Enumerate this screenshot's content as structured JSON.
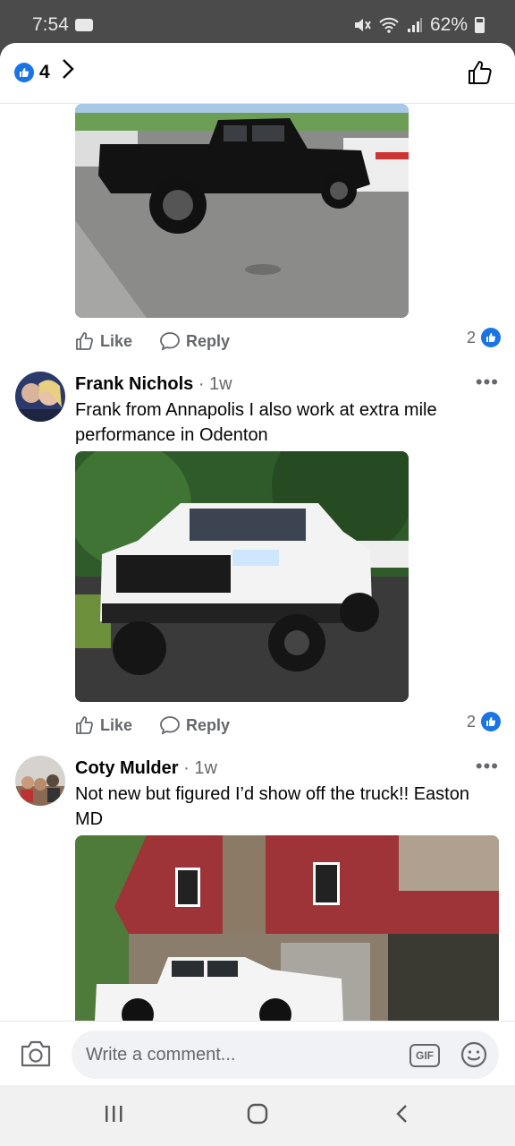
{
  "status": {
    "time": "7:54",
    "battery": "62%"
  },
  "header": {
    "reaction_count": "4",
    "reaction_icon": "like-badge-icon",
    "next_icon": "chevron-right-icon",
    "like_icon": "thumbs-up-icon"
  },
  "comments": [
    {
      "actions": {
        "like": "Like",
        "reply": "Reply"
      },
      "reactions": "2"
    },
    {
      "author": "Frank Nichols",
      "time": "· 1w",
      "text": "Frank from Annapolis I also work at extra mile performance in Odenton",
      "actions": {
        "like": "Like",
        "reply": "Reply"
      },
      "reactions": "2"
    },
    {
      "author": "Coty Mulder",
      "time": "· 1w",
      "text": "Not new but figured I’d show off the truck!! Easton MD"
    }
  ],
  "composer": {
    "placeholder": "Write a comment...",
    "gif_label": "GIF"
  },
  "colors": {
    "accent": "#1b74e4",
    "secondary_text": "#65676b",
    "primary_text": "#050505"
  }
}
